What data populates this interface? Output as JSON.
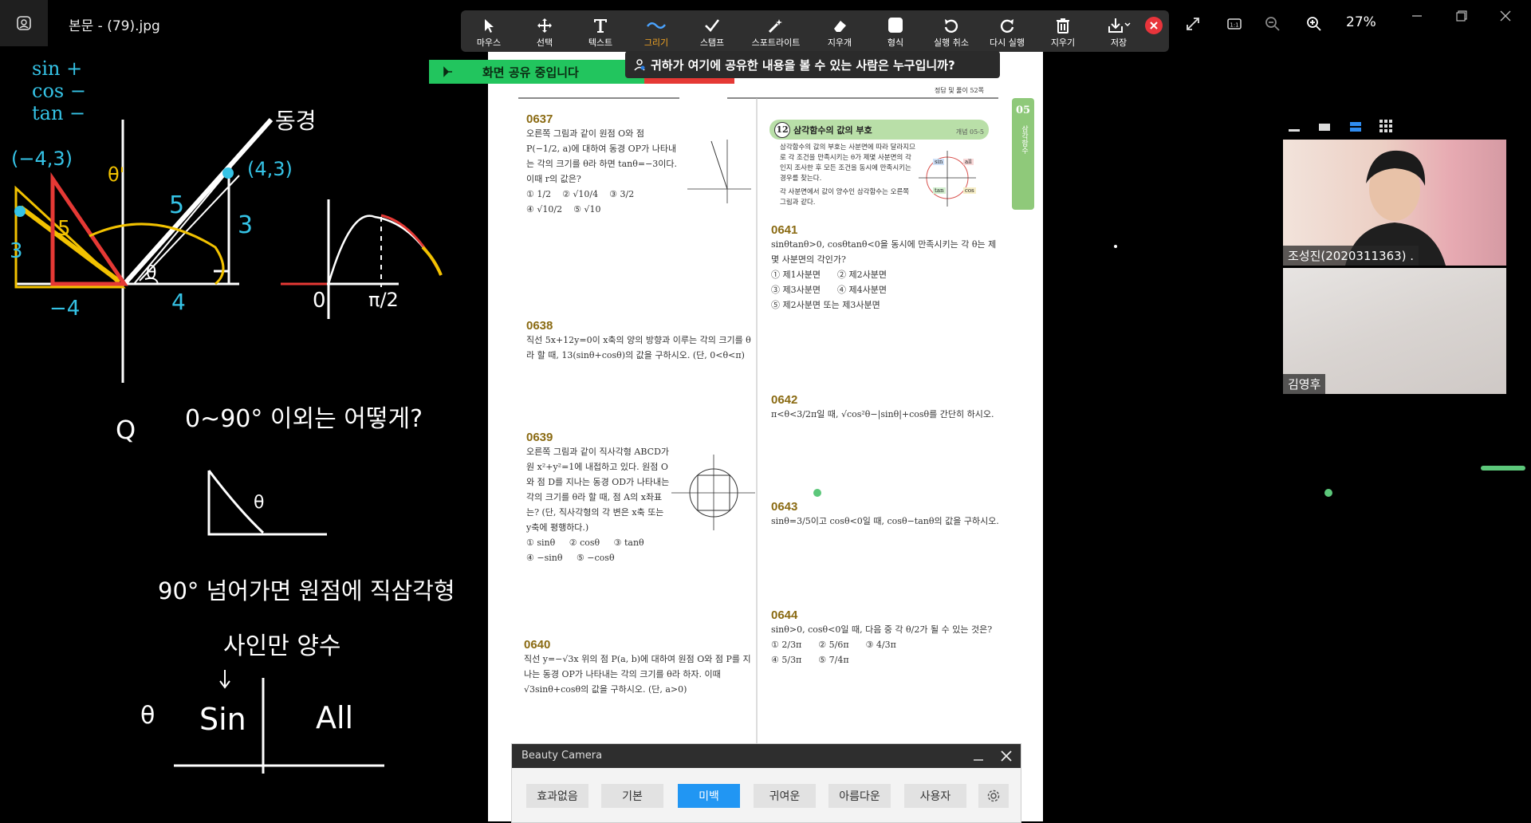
{
  "window": {
    "title": "본문 - (79).jpg",
    "app_icon": "photo-viewer-icon"
  },
  "toolbar": {
    "tools": [
      {
        "label": "마우스",
        "icon": "cursor-icon"
      },
      {
        "label": "선택",
        "icon": "move-icon"
      },
      {
        "label": "텍스트",
        "icon": "text-icon"
      },
      {
        "label": "그리기",
        "icon": "draw-icon",
        "active": true
      },
      {
        "label": "스탬프",
        "icon": "stamp-icon"
      },
      {
        "label": "스포트라이트",
        "icon": "spotlight-icon"
      },
      {
        "label": "지우개",
        "icon": "eraser-icon"
      },
      {
        "label": "형식",
        "icon": "format-icon"
      },
      {
        "label": "실행 취소",
        "icon": "undo-icon"
      },
      {
        "label": "다시 실행",
        "icon": "redo-icon"
      },
      {
        "label": "지우기",
        "icon": "trash-icon"
      },
      {
        "label": "저장",
        "icon": "save-icon"
      }
    ]
  },
  "viewer": {
    "zoom": "27%"
  },
  "share": {
    "banner_text": "화면 공유 중입니다",
    "viewers_tooltip": "귀하가 여기에 공유한 내용을 볼 수 있는 사람은 누구입니까?"
  },
  "document": {
    "header_note": "정답 및 풀이 52쪽",
    "chapter_tab": "05",
    "chapter_name": "삼각함수",
    "concept_box": {
      "number": "12",
      "title": "삼각함수의 값의 부호",
      "ref": "개념 05-5",
      "body": "삼각함수의 값의 부호는 사분면에 따라 달라지므로 각 조건을 만족시키는 θ가 제몇 사분면의 각인지 조사한 후 모든 조건을 동시에 만족시키는 경우를 찾는다.",
      "note": "각 사분면에서 값이 양수인 삼각함수는 오른쪽 그림과 같다.",
      "quadrant_labels": [
        "sin",
        "all",
        "tan",
        "cos"
      ]
    },
    "questions": [
      {
        "num": "0637",
        "text": "오른쪽 그림과 같이 원점 O와 점 P(−1/2, a)에 대하여 동경 OP가 나타내는 각의 크기를 θ라 하면 tanθ=−3이다. 이때 r의 값은?",
        "options": [
          "① 1/2",
          "② √10/4",
          "③ 3/2",
          "④ √10/2",
          "⑤ √10"
        ]
      },
      {
        "num": "0638",
        "text": "직선 5x+12y=0이 x축의 양의 방향과 이루는 각의 크기를 θ라 할 때, 13(sinθ+cosθ)의 값을 구하시오. (단, 0<θ<π)"
      },
      {
        "num": "0639",
        "text": "오른쪽 그림과 같이 직사각형 ABCD가 원 x²+y²=1에 내접하고 있다. 원점 O와 점 D를 지나는 동경 OD가 나타내는 각의 크기를 θ라 할 때, 점 A의 x좌표는? (단, 직사각형의 각 변은 x축 또는 y축에 평행하다.)",
        "options": [
          "① sinθ",
          "② cosθ",
          "③ tanθ",
          "④ −sinθ",
          "⑤ −cosθ"
        ]
      },
      {
        "num": "0640",
        "text": "직선 y=−√3x 위의 점 P(a, b)에 대하여 원점 O와 점 P를 지나는 동경 OP가 나타내는 각의 크기를 θ라 하자. 이때 √3sinθ+cosθ의 값을 구하시오. (단, a>0)"
      },
      {
        "num": "0641",
        "text": "sinθtanθ>0, cosθtanθ<0을 동시에 만족시키는 각 θ는 제몇 사분면의 각인가?",
        "options": [
          "① 제1사분면",
          "② 제2사분면",
          "③ 제3사분면",
          "④ 제4사분면",
          "⑤ 제2사분면 또는 제3사분면"
        ]
      },
      {
        "num": "0642",
        "text": "π<θ<3/2π일 때, √cos²θ−|sinθ|+cosθ를 간단히 하시오."
      },
      {
        "num": "0643",
        "text": "sinθ=3/5이고 cosθ<0일 때, cosθ−tanθ의 값을 구하시오."
      },
      {
        "num": "0644",
        "text": "sinθ>0, cosθ<0일 때, 다음 중 각 θ/2가 될 수 있는 것은?",
        "options": [
          "① 2/3π",
          "② 5/6π",
          "③ 4/3π",
          "④ 5/3π",
          "⑤ 7/4π"
        ]
      }
    ]
  },
  "beauty_camera": {
    "title": "Beauty Camera",
    "filters": [
      "효과없음",
      "기본",
      "미백",
      "귀여운",
      "아름다운",
      "사용자"
    ],
    "selected": "미백"
  },
  "participants": [
    {
      "name": "조성진(2020311363) ."
    },
    {
      "name": "김영후"
    }
  ],
  "whiteboard": {
    "labels": [
      "sin +",
      "cos −",
      "tan −",
      "(−4,3)",
      "(4,3)",
      "동경",
      "θ'",
      "θ",
      "5",
      "5",
      "3",
      "3",
      "−4",
      "4",
      "0",
      "π/2",
      "Q",
      "0~90° 이외는 어떻게?",
      "θ",
      "90° 넘어가면 원점에 직삼각형",
      "사인만 양수",
      "θ",
      "Sin",
      "All"
    ]
  },
  "colors": {
    "accent": "#f5a623",
    "share_green": "#22c55e",
    "stop_red": "#e8343b",
    "selected_blue": "#2196f3"
  }
}
